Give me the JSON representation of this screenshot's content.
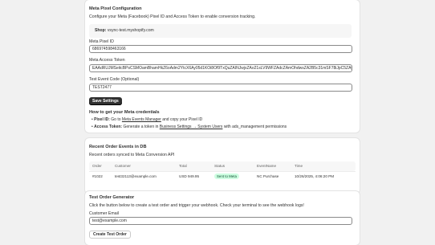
{
  "config": {
    "title": "Meta Pixel Configuration",
    "description": "Configure your Meta (Facebook) Pixel ID and Access Token to enable conversion tracking.",
    "shop_label": "Shop:",
    "shop_value": "vsync-test.myshopify.com",
    "pixel_id_label": "Meta Pixel ID",
    "pixel_id_value": "686974598463166",
    "access_token_label": "Meta Access Token",
    "access_token_value": "EAAdRUJMSeitcBPsCSMOamBhamHkZ6oAdm2YtcX6Ay05d1KOi8Of9TxQuZAINJwjxZAo21sLV9WFZAdcZAmOhdwsZA2B5c31mSF78iJpC5ZAyC",
    "test_code_label": "Test Event Code (Optional)",
    "test_code_value": "TEST2477",
    "save_label": "Save Settings",
    "howto_title": "How to get your Meta credentials",
    "pixel_id_bullet_bold": "Pixel ID:",
    "pixel_id_bullet_pre": "Go to",
    "pixel_id_bullet_link": "Meta Events Manager",
    "pixel_id_bullet_post": "and copy your Pixel ID",
    "token_bullet_bold": "Access Token:",
    "token_bullet_pre": "Generate a token in",
    "token_bullet_link": "Business Settings → System Users",
    "token_bullet_post": "with ads_management permissions"
  },
  "events": {
    "title": "Recent Order Events in DB",
    "description": "Recent orders synced to Meta Conversion API",
    "columns": [
      "Order",
      "Customer",
      "Total",
      "Status",
      "EventName",
      "Time"
    ],
    "rows": [
      {
        "order": "#1022",
        "customer": "test32113@example.com",
        "total": "USD 949.95",
        "status": "Sent to Meta",
        "event_name": "NC Purchase",
        "time": "10/26/2025, 4:06:20 PM"
      }
    ],
    "status_color": "#cdfee1"
  },
  "test_order": {
    "title": "Test Order Generator",
    "description": "Click the button below to create a test order and trigger your webhook. Check your terminal to see the webhook logs!",
    "email_label": "Customer Email",
    "email_value": "test@example.com",
    "create_label": "Create Test Order"
  }
}
